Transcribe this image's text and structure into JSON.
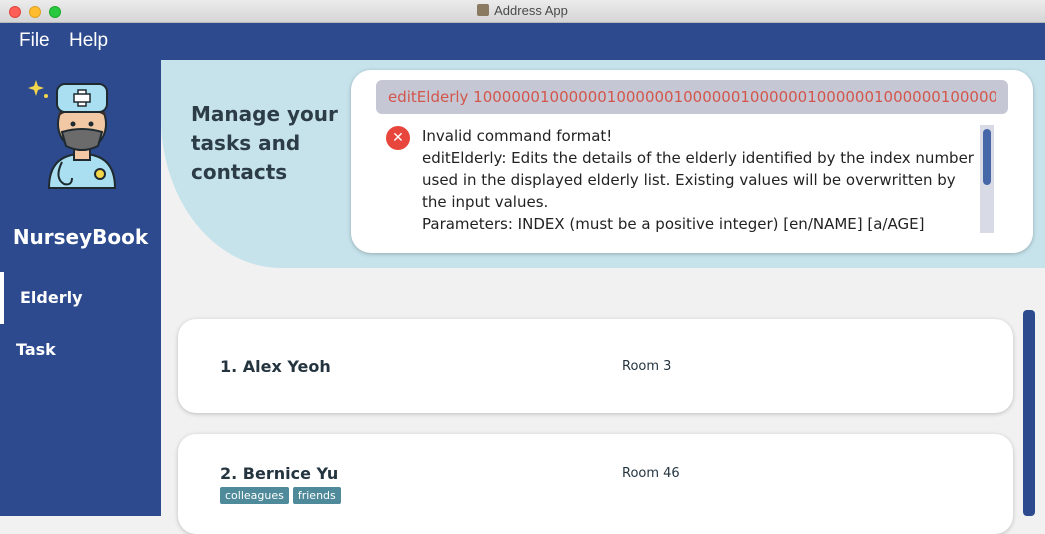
{
  "window": {
    "title": "Address App"
  },
  "menu": {
    "items": [
      "File",
      "Help"
    ]
  },
  "sidebar": {
    "brand": "NurseyBook",
    "nav": [
      {
        "label": "Elderly"
      },
      {
        "label": "Task"
      }
    ]
  },
  "header": {
    "tagline": "Manage your tasks and contacts"
  },
  "command": {
    "value": "editElderly 10000001000000100000010000001000000100000010000001000000",
    "result": "Invalid command format!\neditElderly: Edits the details of the elderly identified by the index number used in the displayed elderly list. Existing values will be overwritten by the input values.\nParameters: INDEX (must be a positive integer) [en/NAME] [a/AGE]"
  },
  "elderly": [
    {
      "name": "1. Alex Yeoh",
      "room": "Room 3",
      "tags": []
    },
    {
      "name": "2. Bernice Yu",
      "room": "Room 46",
      "tags": [
        "colleagues",
        "friends"
      ]
    }
  ],
  "colors": {
    "primary": "#2c4a8d",
    "banner": "#c6e3ec",
    "error": "#e8453c",
    "command_text": "#d3564b",
    "tag": "#4e8a9a"
  },
  "icons": {
    "logo": "nurse-icon",
    "result_status": "error-icon",
    "app": "app-icon"
  }
}
